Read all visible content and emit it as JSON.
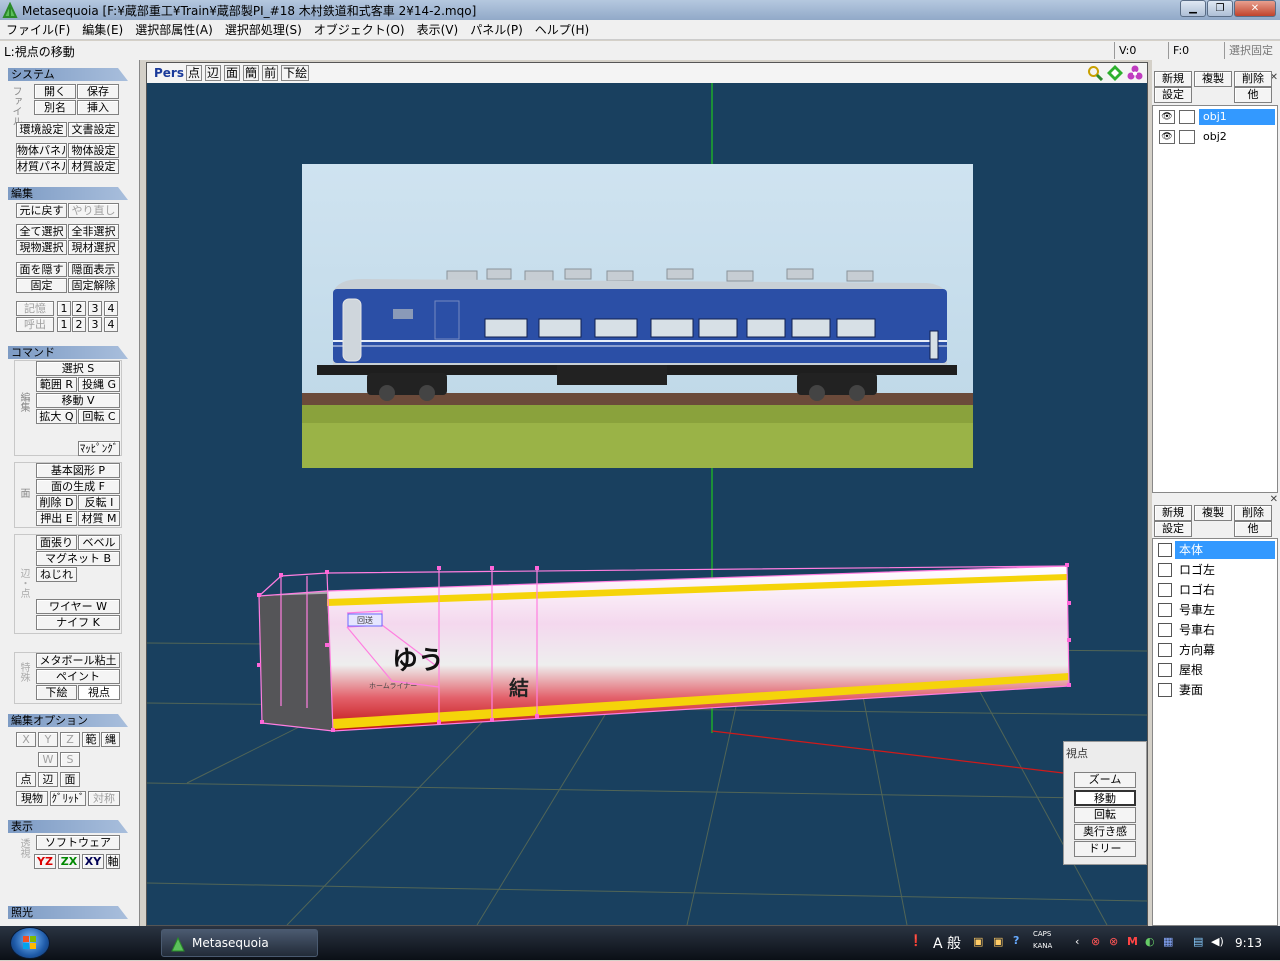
{
  "window": {
    "title": "Metasequoia [F:¥蔵部重工¥Train¥蔵部製PI_#18 木村鉄道和式客車 2¥14-2.mqo]"
  },
  "menu": [
    "ファイル(F)",
    "編集(E)",
    "選択部属性(A)",
    "選択部処理(S)",
    "オブジェクト(O)",
    "表示(V)",
    "パネル(P)",
    "ヘルプ(H)"
  ],
  "status": {
    "hint": "L:視点の移動",
    "v": "V:0",
    "f": "F:0",
    "lock": "選択固定"
  },
  "left": {
    "system": {
      "title": "システム",
      "sidelabel": "ファイル",
      "open": "開く",
      "save": "保存",
      "saveas": "別名",
      "insert": "挿入",
      "env": "環境設定",
      "docset": "文書設定",
      "objpanel": "物体パネル",
      "objset": "物体設定",
      "matpanel": "材質パネル",
      "matset": "材質設定"
    },
    "edit": {
      "title": "編集",
      "undo": "元に戻す",
      "redo": "やり直し",
      "selall": "全て選択",
      "deselall": "全非選択",
      "curobj": "現物選択",
      "curmat": "現材選択",
      "hide": "面を隠す",
      "showhidden": "隠面表示",
      "fix": "固定",
      "unfix": "固定解除",
      "mem": "記憶",
      "recall": "呼出",
      "n1": "1",
      "n2": "2",
      "n3": "3",
      "n4": "4"
    },
    "command": {
      "title": "コマンド",
      "sidelabel": "編集",
      "sel": "選択 S",
      "range": "範囲 R",
      "lasso": "投縄 G",
      "move": "移動 V",
      "scale": "拡大 Q",
      "rotate": "回転 C",
      "mapping": "ﾏｯﾋﾟﾝｸﾞ",
      "facelabel": "面",
      "prim": "基本図形 P",
      "facegen": "面の生成 F",
      "del": "削除 D",
      "flip": "反転 I",
      "extrude": "押出 E",
      "mat": "材質 M",
      "edgelabel": "辺・点",
      "stretch": "面張り",
      "bevel": "ベベル",
      "magnet": "マグネット B",
      "twist": "ねじれ",
      "wire": "ワイヤー W",
      "knife": "ナイフ K",
      "speciallabel": "特殊",
      "metaball": "メタボール粘土",
      "paint": "ペイント",
      "underlay": "下絵",
      "viewpoint": "視点"
    },
    "editopt": {
      "title": "編集オプション",
      "x": "X",
      "y": "Y",
      "z": "Z",
      "range": "範",
      "rope": "縄",
      "w": "W",
      "s": "S",
      "pt": "点",
      "edge": "辺",
      "face": "面",
      "curobj": "現物",
      "grid": "ｸﾞﾘｯﾄﾞ",
      "sym": "対称"
    },
    "display": {
      "title": "表示",
      "sidelabel": "透視",
      "software": "ソフトウェア",
      "yz": "YZ",
      "zx": "ZX",
      "xy": "XY",
      "axis": "軸"
    },
    "lighting": {
      "title": "照光"
    }
  },
  "viewport": {
    "mode": "Pers",
    "point": "点",
    "edge": "辺",
    "face": "面",
    "simple": "簡",
    "front": "前",
    "underlay": "下絵"
  },
  "viewpanel": {
    "title": "視点",
    "zoom": "ズーム",
    "move": "移動",
    "rotate": "回転",
    "depth": "奥行き感",
    "dolly": "ドリー"
  },
  "objpanel": {
    "new": "新規",
    "dup": "複製",
    "del": "削除",
    "settings": "設定",
    "other": "他",
    "items": [
      "obj1",
      "obj2"
    ],
    "selected": 0
  },
  "matpanel": {
    "new": "新規",
    "dup": "複製",
    "del": "削除",
    "settings": "設定",
    "other": "他",
    "items": [
      "本体",
      "ロゴ左",
      "ロゴ右",
      "号車左",
      "号車右",
      "方向幕",
      "屋根",
      "妻面"
    ],
    "selected": 0
  },
  "model": {
    "sign": "回送",
    "logo": "ゆう",
    "logo_small": "ホームライナー",
    "kanji": "結"
  },
  "taskbar": {
    "app": "Metasequoia",
    "time": "9:13",
    "ime": "A 般",
    "caps": "CAPS",
    "kana": "KANA"
  },
  "colors": {
    "viewport_bg": "#19405f",
    "train_blue": "#2b4fa6",
    "stripe_yellow": "#f5d40a",
    "stripe_red": "#d11c1c",
    "select_blue": "#3399ff"
  }
}
